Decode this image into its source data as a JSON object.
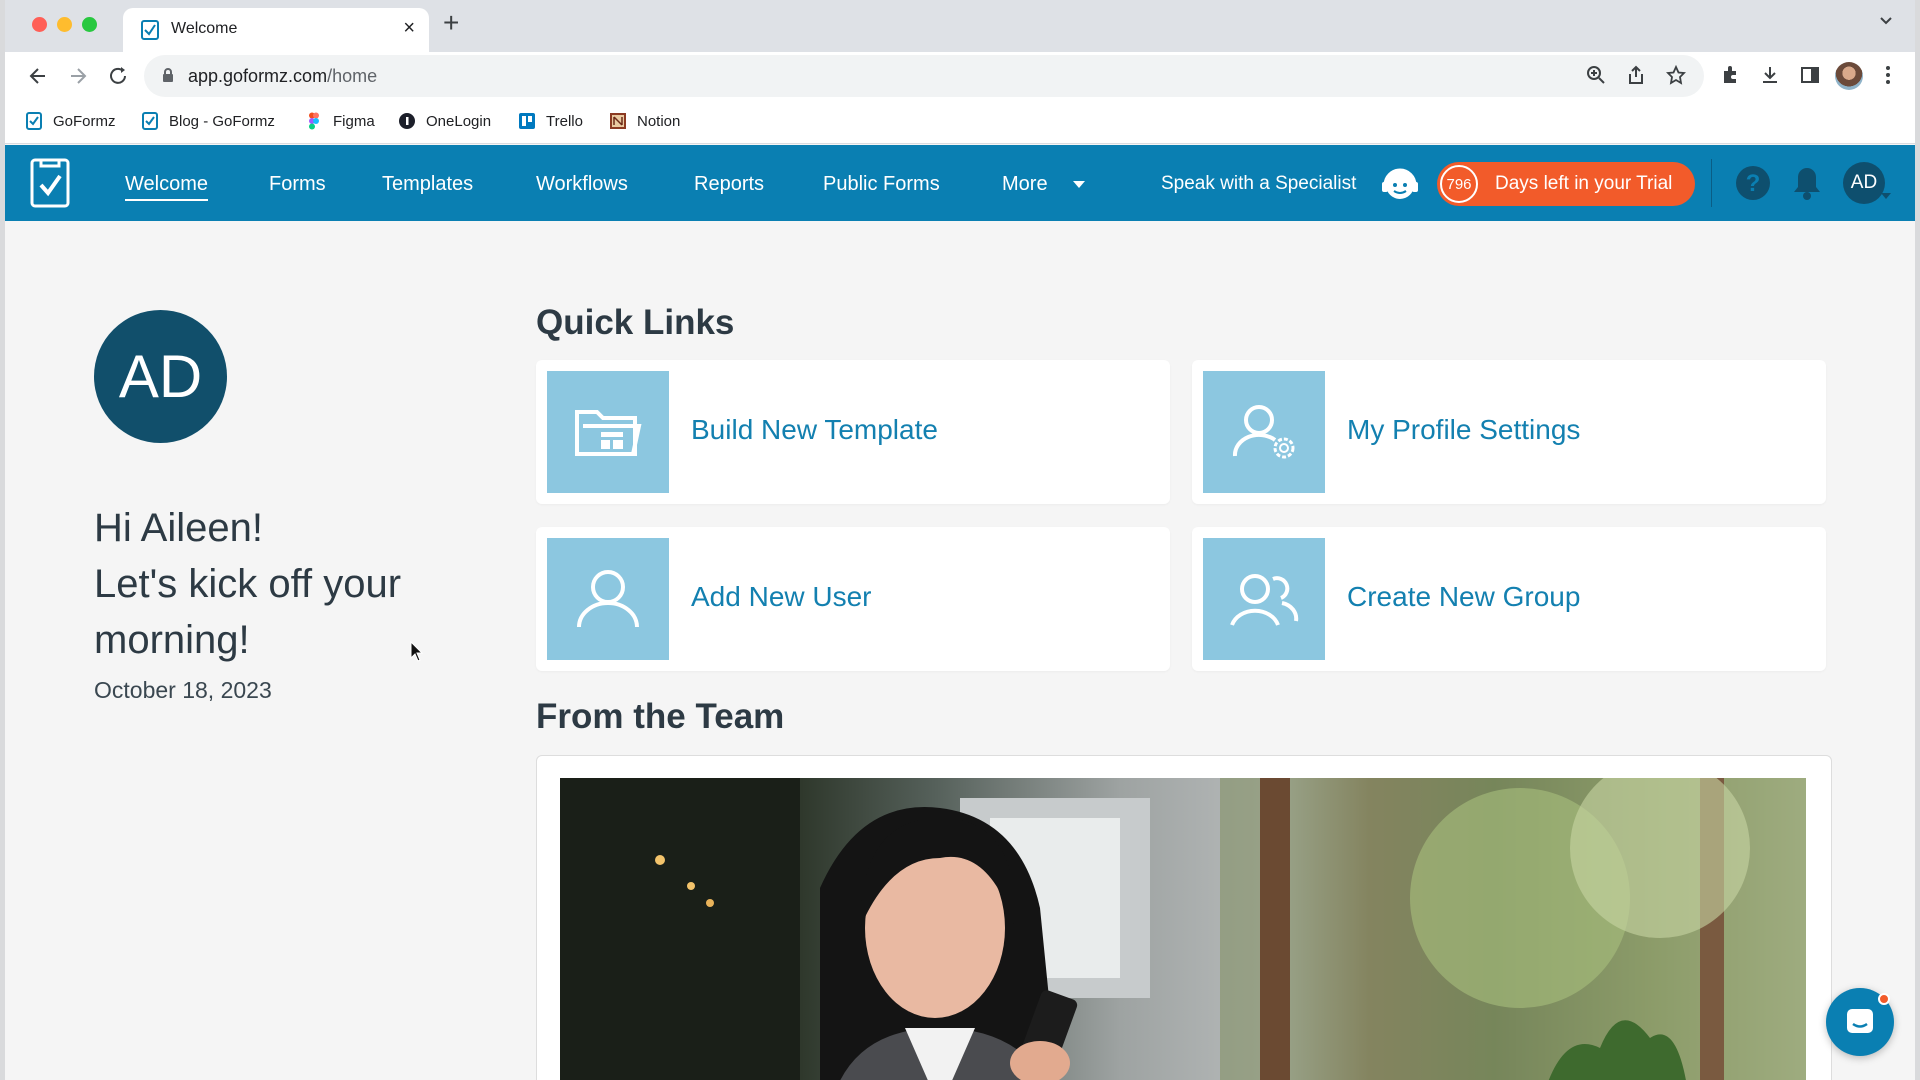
{
  "browser": {
    "tab_title": "Welcome",
    "url_host": "app.goformz.com",
    "url_path": "/home",
    "bookmarks": [
      {
        "label": "GoFormz",
        "icon": "goformz-icon"
      },
      {
        "label": "Blog - GoFormz",
        "icon": "goformz-icon"
      },
      {
        "label": "Figma",
        "icon": "figma-icon"
      },
      {
        "label": "OneLogin",
        "icon": "onelogin-icon"
      },
      {
        "label": "Trello",
        "icon": "trello-icon"
      },
      {
        "label": "Notion",
        "icon": "notion-icon"
      }
    ]
  },
  "nav": {
    "items": [
      "Welcome",
      "Forms",
      "Templates",
      "Workflows",
      "Reports",
      "Public Forms",
      "More"
    ],
    "active": "Welcome",
    "specialist": "Speak with a Specialist",
    "trial_count": "796",
    "trial_text": "Days left in your Trial",
    "avatar": "AD"
  },
  "profile": {
    "initials": "AD",
    "greeting": "Hi Aileen!",
    "subtitle": "Let's kick off your morning!",
    "date": "October 18, 2023"
  },
  "quick_links": {
    "title": "Quick Links",
    "items": [
      {
        "label": "Build New Template",
        "icon": "folder-template-icon"
      },
      {
        "label": "My Profile Settings",
        "icon": "user-settings-icon"
      },
      {
        "label": "Add New User",
        "icon": "user-icon"
      },
      {
        "label": "Create New Group",
        "icon": "group-icon"
      }
    ]
  },
  "team": {
    "title": "From the Team"
  },
  "colors": {
    "brand": "#0a7fb2",
    "trial": "#f25b2a",
    "link": "#1380b0",
    "tile": "#8cc7e0"
  }
}
